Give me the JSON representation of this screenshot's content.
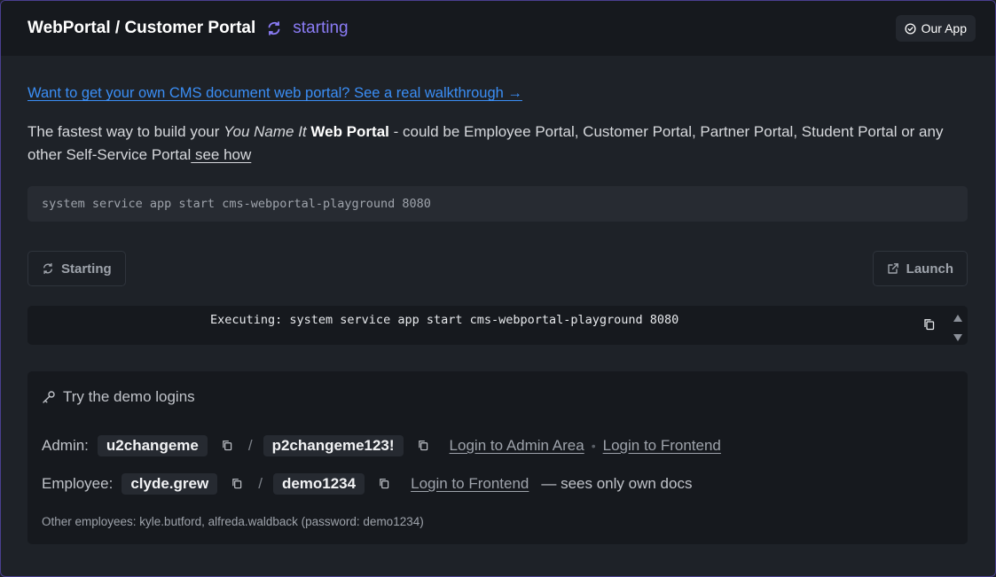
{
  "header": {
    "title": "WebPortal / Customer Portal",
    "status": "starting",
    "app_button": "Our App"
  },
  "walkthrough_link": "Want to get your own CMS document web portal? See a real walkthrough →",
  "intro": {
    "part1": "The fastest way to build your ",
    "italic": "You Name It",
    "space": " ",
    "bold": "Web Portal",
    "part2": " - could be Employee Portal, Customer Portal, Partner Portal, Student Portal or any other Self-Service Portal",
    "see_how": " see how"
  },
  "command": "system service app start cms-webportal-playground 8080",
  "buttons": {
    "starting": "Starting",
    "launch": "Launch"
  },
  "output": {
    "line": "Executing: system service app start cms-webportal-playground 8080"
  },
  "demo": {
    "title": "Try the demo logins",
    "admin": {
      "label": "Admin:",
      "username": "u2changeme",
      "password": "p2changeme123!",
      "login_admin": "Login to Admin Area",
      "login_frontend": "Login to Frontend"
    },
    "employee": {
      "label": "Employee:",
      "username": "clyde.grew",
      "password": "demo1234",
      "login_frontend": "Login to Frontend",
      "note": "— sees only own docs"
    },
    "others": "Other employees: kyle.butford, alfreda.waldback (password: demo1234)"
  },
  "colors": {
    "accent": "#8b7cf6",
    "link": "#3b8ef5",
    "background": "#1e2228",
    "header_bg": "#16191e"
  }
}
